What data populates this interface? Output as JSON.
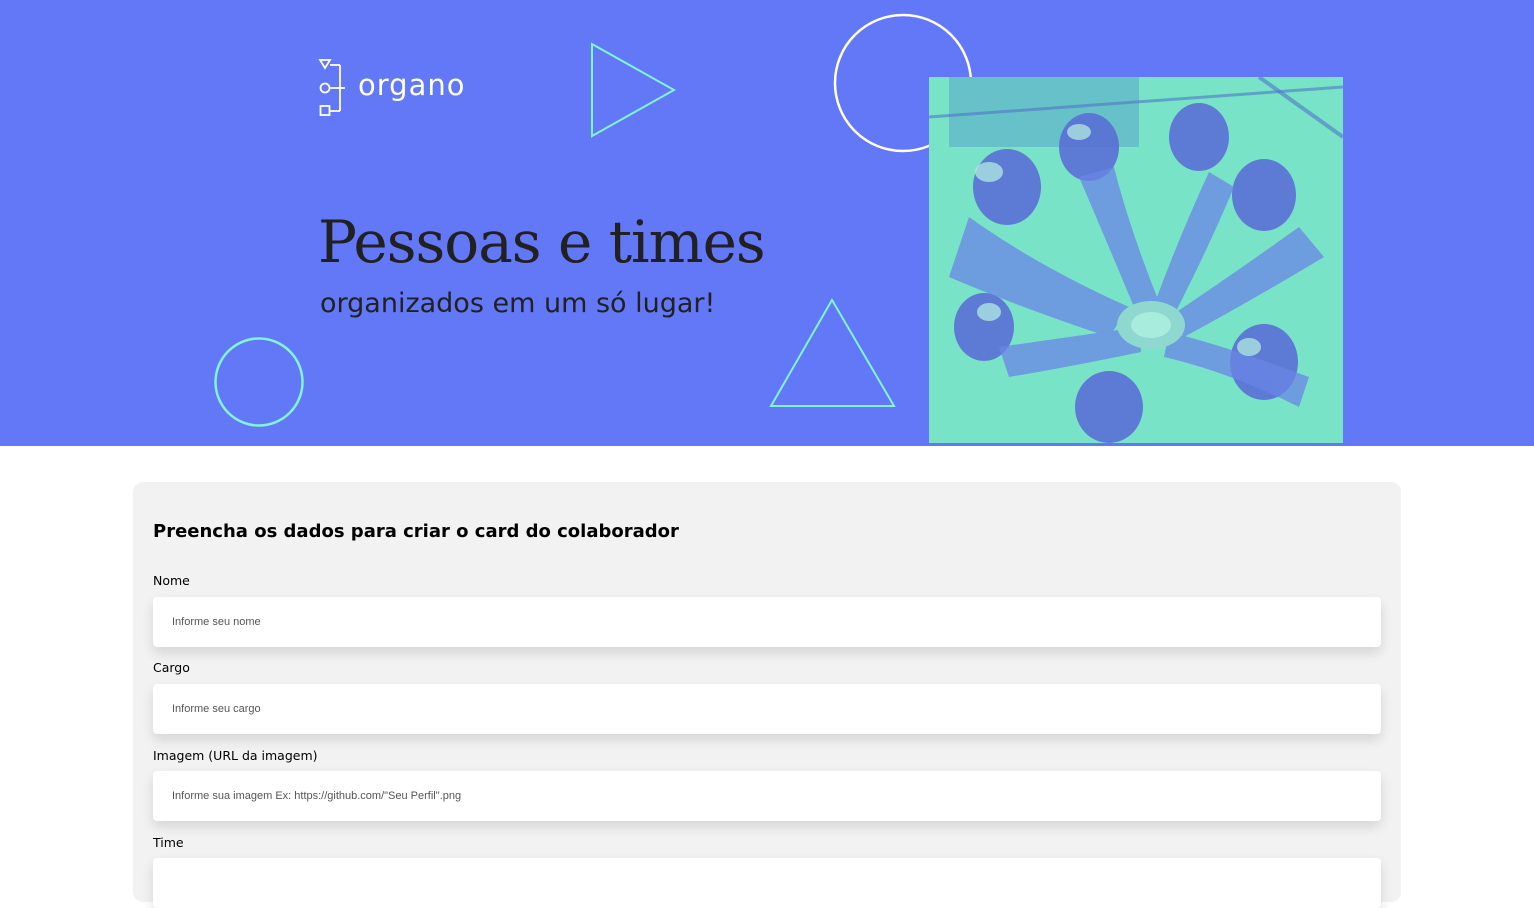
{
  "banner": {
    "background_color": "#6278f7",
    "accent_color": "#7ff5d4",
    "logo": {
      "text": "organo",
      "icon": "org-chart-icon"
    },
    "headline": "Pessoas e times",
    "subheadline": "organizados em um só lugar!",
    "photo": {
      "subject": "team-hands-together-photo",
      "tint": "#79e3c7"
    }
  },
  "form": {
    "title": "Preencha os dados para criar o card do colaborador",
    "fields": [
      {
        "label": "Nome",
        "value": "",
        "placeholder": "Informe seu nome"
      },
      {
        "label": "Cargo",
        "value": "",
        "placeholder": "Informe seu cargo"
      },
      {
        "label": "Imagem (URL da imagem)",
        "value": "",
        "placeholder": "Informe sua imagem Ex: https://github.com/\"Seu Perfil\".png"
      },
      {
        "label": "Time",
        "value": "",
        "placeholder": ""
      }
    ]
  }
}
